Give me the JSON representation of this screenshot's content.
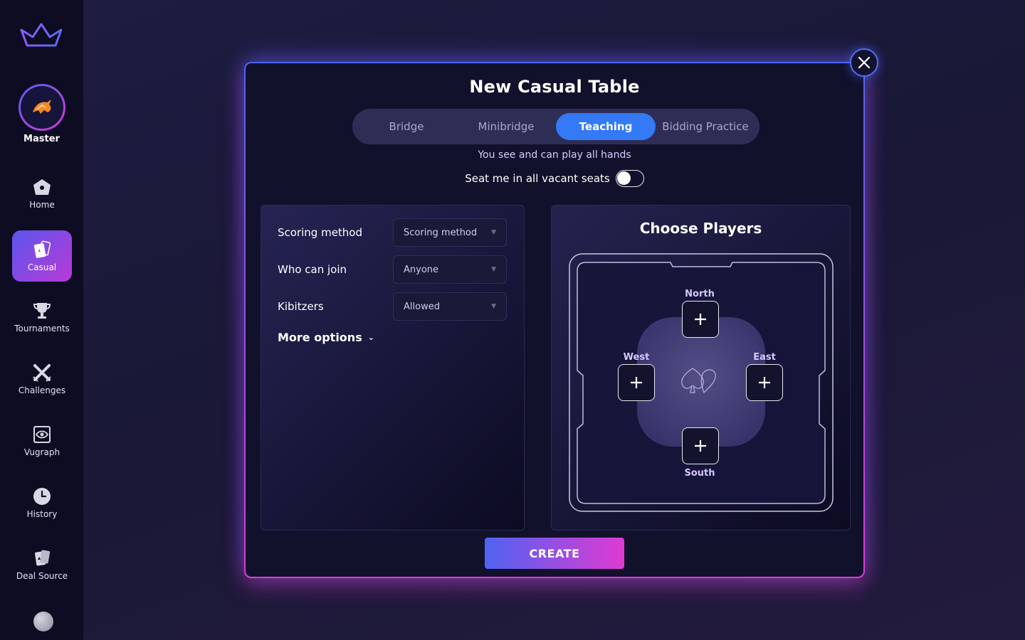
{
  "sidebar": {
    "rank": "Master",
    "items": [
      {
        "label": "Home",
        "icon": "home-icon"
      },
      {
        "label": "Casual",
        "icon": "cards-icon",
        "active": true
      },
      {
        "label": "Tournaments",
        "icon": "trophy-icon"
      },
      {
        "label": "Challenges",
        "icon": "crossed-swords-icon"
      },
      {
        "label": "Vugraph",
        "icon": "eye-icon"
      },
      {
        "label": "History",
        "icon": "clock-icon"
      },
      {
        "label": "Deal Source",
        "icon": "deal-cards-icon"
      }
    ]
  },
  "modal": {
    "title": "New Casual Table",
    "tabs": [
      {
        "label": "Bridge"
      },
      {
        "label": "Minibridge"
      },
      {
        "label": "Teaching",
        "active": true
      },
      {
        "label": "Bidding Practice"
      }
    ],
    "mode_description": "You see and can play all hands",
    "seat_toggle_label": "Seat me in all vacant seats",
    "seat_toggle_on": false,
    "options": {
      "scoring": {
        "label": "Scoring method",
        "value": "Scoring method"
      },
      "who_can_join": {
        "label": "Who can join",
        "value": "Anyone"
      },
      "kibitzers": {
        "label": "Kibitzers",
        "value": "Allowed"
      },
      "more_options": "More options"
    },
    "players": {
      "title": "Choose Players",
      "north": "North",
      "south": "South",
      "east": "East",
      "west": "West"
    },
    "create_label": "CREATE"
  },
  "colors": {
    "accent_blue": "#3479f6",
    "gradient_start": "#4e63f2",
    "gradient_end": "#df3ad2",
    "sidebar_bg": "#0d0c22"
  }
}
